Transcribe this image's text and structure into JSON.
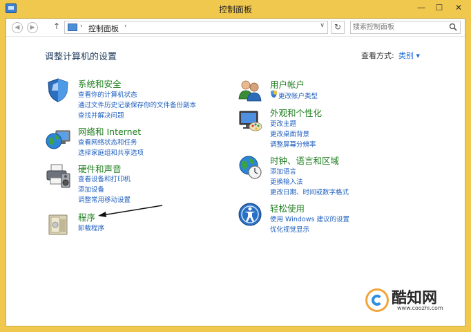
{
  "window": {
    "title": "控制面板",
    "minimize_glyph": "—",
    "maximize_glyph": "☐",
    "close_glyph": "✕"
  },
  "addressbar": {
    "back_glyph": "◀",
    "forward_glyph": "▶",
    "up_glyph": "↑",
    "path": [
      "控制面板"
    ],
    "path_separator": "›",
    "dropdown_glyph": "∨",
    "refresh_glyph": "↻",
    "search_placeholder": "搜索控制面板"
  },
  "main": {
    "title": "调整计算机的设置",
    "view_by_label": "查看方式:",
    "view_by_value": "类别 ▾"
  },
  "categories": [
    {
      "id": "system-security",
      "title": "系统和安全",
      "icon": "shield-icon",
      "links": [
        "查看你的计算机状态",
        "通过文件历史记录保存你的文件备份副本",
        "查找并解决问题"
      ]
    },
    {
      "id": "network-internet",
      "title": "网络和 Internet",
      "icon": "network-globe-icon",
      "links": [
        "查看网络状态和任务",
        "选择家庭组和共享选项"
      ]
    },
    {
      "id": "hardware-sound",
      "title": "硬件和声音",
      "icon": "printer-speaker-icon",
      "links": [
        "查看设备和打印机",
        "添加设备",
        "调整常用移动设置"
      ]
    },
    {
      "id": "programs",
      "title": "程序",
      "icon": "programs-box-icon",
      "links": [
        "卸载程序"
      ]
    },
    {
      "id": "user-accounts",
      "title": "用户帐户",
      "icon": "users-icon",
      "links": [
        "更改帐户类型"
      ]
    },
    {
      "id": "appearance",
      "title": "外观和个性化",
      "icon": "monitor-palette-icon",
      "links": [
        "更改主题",
        "更改桌面背景",
        "调整屏幕分辨率"
      ]
    },
    {
      "id": "clock-language",
      "title": "时钟、语言和区域",
      "icon": "clock-globe-icon",
      "links": [
        "添加语言",
        "更换输入法",
        "更改日期、时间或数字格式"
      ]
    },
    {
      "id": "ease-of-access",
      "title": "轻松使用",
      "icon": "ease-of-access-icon",
      "links": [
        "使用 Windows 建议的设置",
        "优化视觉显示"
      ]
    }
  ],
  "watermark": {
    "name": "酷知网",
    "url": "www.coozhi.com"
  },
  "colors": {
    "frame": "#f1c84e",
    "category_title": "#1e7e1e",
    "link": "#1f5fbf",
    "view_value": "#1f6fd8"
  }
}
